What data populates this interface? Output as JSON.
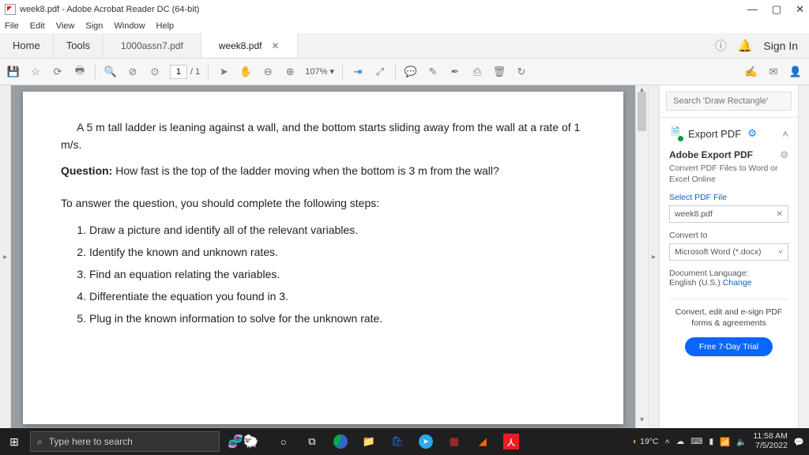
{
  "title": "week8.pdf - Adobe Acrobat Reader DC (64-bit)",
  "menus": {
    "file": "File",
    "edit": "Edit",
    "view": "View",
    "sign": "Sign",
    "window": "Window",
    "help": "Help"
  },
  "tabs": {
    "home": "Home",
    "tools": "Tools",
    "doc1": "1000assn7.pdf",
    "doc2": "week8.pdf",
    "signin": "Sign In"
  },
  "toolbar": {
    "page_current": "1",
    "page_total": "/ 1",
    "zoom": "107%"
  },
  "document": {
    "intro": "A 5 m tall ladder is leaning against a wall, and the bottom starts sliding away from the wall at a rate of 1 m/s.",
    "question_label": "Question:",
    "question_text": " How fast is the top of the ladder moving when the bottom is 3 m from the wall?",
    "steps_lead": "To answer the question, you should complete the following steps:",
    "steps": [
      "Draw a picture and identify all of the relevant variables.",
      "Identify the known and unknown rates.",
      "Find an equation relating the variables.",
      "Differentiate the equation you found in 3.",
      "Plug in the known information to solve for the unknown rate."
    ]
  },
  "side": {
    "search_placeholder": "Search 'Draw Rectangle'",
    "export_label": "Export PDF",
    "panel_title": "Adobe Export PDF",
    "panel_sub": "Convert PDF Files to Word or Excel Online",
    "select_label": "Select PDF File",
    "selected_file": "week8.pdf",
    "convert_label": "Convert to",
    "convert_value": "Microsoft Word (*.docx)",
    "lang_label": "Document Language:",
    "lang_value": "English (U.S.) ",
    "lang_change": "Change",
    "promo_line1": "Convert, edit and e-sign PDF",
    "promo_line2": "forms & agreements",
    "trial": "Free 7-Day Trial"
  },
  "taskbar": {
    "search_placeholder": "Type here to search",
    "weather": "19°C",
    "time": "11:58 AM",
    "date": "7/5/2022"
  }
}
